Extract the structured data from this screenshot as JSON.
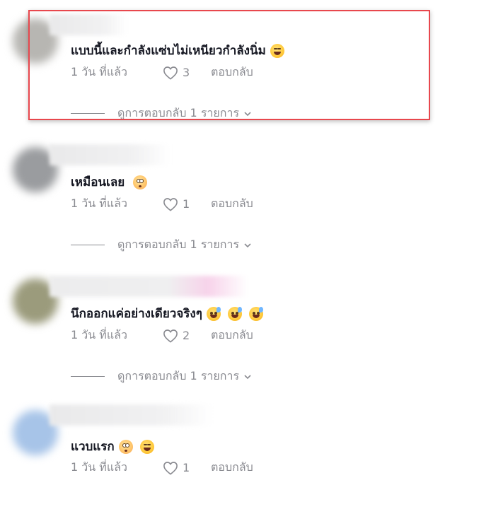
{
  "comments": [
    {
      "text": "แบบนี้และกำลังแซ่บไม่เหนียวกำลังนิ่ม",
      "emoji": [
        "laugh-cry-emoji"
      ],
      "time": "1 วัน ที่แล้ว",
      "likes": "3",
      "reply_label": "ตอบกลับ",
      "view_replies": "ดูการตอบกลับ 1 รายการ",
      "highlighted": true
    },
    {
      "text": "เหมือนเลย",
      "emoji": [
        "flushed-emoji"
      ],
      "time": "1 วัน ที่แล้ว",
      "likes": "1",
      "reply_label": "ตอบกลับ",
      "view_replies": "ดูการตอบกลับ 1 รายการ",
      "highlighted": false
    },
    {
      "text": "นึกออกแค่อย่างเดียวจริงๆ",
      "emoji": [
        "sweat-smile-emoji",
        "sweat-smile-emoji",
        "sweat-smile-emoji"
      ],
      "time": "1 วัน ที่แล้ว",
      "likes": "2",
      "reply_label": "ตอบกลับ",
      "view_replies": "ดูการตอบกลับ 1 รายการ",
      "highlighted": false
    },
    {
      "text": "แวบแรก",
      "emoji": [
        "flushed-emoji",
        "laugh-cry-emoji"
      ],
      "time": "1 วัน ที่แล้ว",
      "likes": "1",
      "reply_label": "ตอบกลับ",
      "highlighted": false
    }
  ],
  "colors": {
    "highlight_border": "#e8474d",
    "meta_text": "#8a8b91",
    "primary_text": "#161823"
  }
}
